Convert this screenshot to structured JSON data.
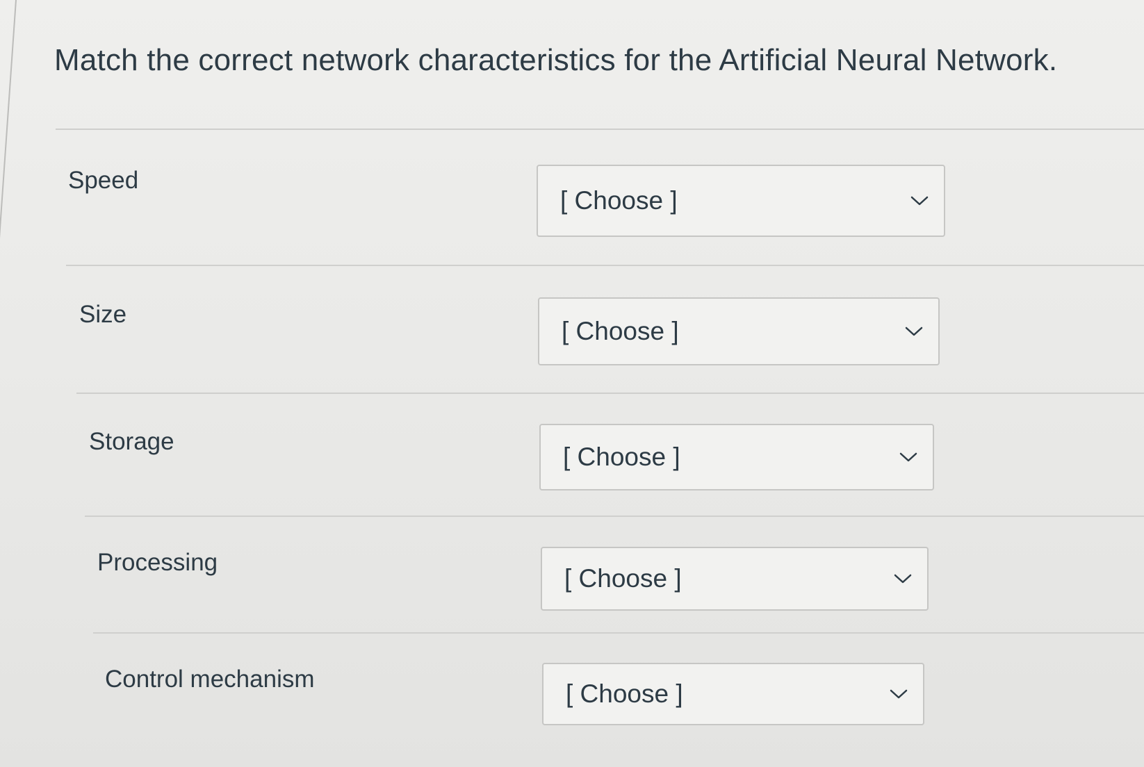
{
  "question": {
    "title": "Match the correct network characteristics for the Artificial Neural Network."
  },
  "rows": [
    {
      "label": "Speed",
      "selected": "[ Choose ]"
    },
    {
      "label": "Size",
      "selected": "[ Choose ]"
    },
    {
      "label": "Storage",
      "selected": "[ Choose ]"
    },
    {
      "label": "Processing",
      "selected": "[ Choose ]"
    },
    {
      "label": "Control mechanism",
      "selected": "[ Choose ]"
    }
  ],
  "icons": {
    "dropdown": "chevron-down-icon"
  },
  "colors": {
    "text": "#2d3b45",
    "select_border": "#c6c6c4",
    "background": "#ececea"
  }
}
